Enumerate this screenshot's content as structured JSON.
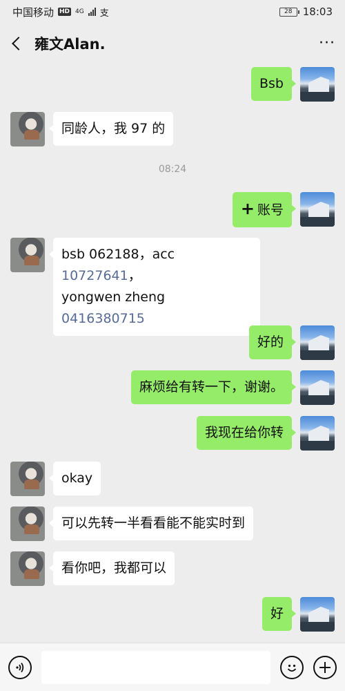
{
  "statusbar": {
    "carrier": "中国移动",
    "hd": "HD",
    "network": "4G",
    "extra_icon": "支",
    "battery": "28",
    "time": "18:03"
  },
  "header": {
    "title": "雍文Alan.",
    "more": "···"
  },
  "messages": [
    {
      "side": "out",
      "text": "Bsb"
    },
    {
      "side": "in",
      "text": "同龄人，我 97 的"
    },
    {
      "type": "time",
      "text": "08:24"
    },
    {
      "side": "out",
      "icon": "+",
      "text": "账号"
    },
    {
      "side": "in",
      "parts": [
        "bsb 062188，acc ",
        "10727641",
        "，",
        "yongwen zheng",
        "0416380715"
      ]
    },
    {
      "side": "out",
      "text": "好的"
    },
    {
      "side": "out",
      "text": "麻烦给有转一下，谢谢。"
    },
    {
      "side": "out",
      "text": "我现在给你转"
    },
    {
      "side": "in",
      "text": "okay"
    },
    {
      "side": "in",
      "text": "可以先转一半看看能不能实时到"
    },
    {
      "side": "in",
      "text": "看你吧，我都可以"
    },
    {
      "side": "out",
      "text": "好"
    }
  ],
  "inputbar": {
    "voice_icon": "voice-icon",
    "emoji_icon": "emoji-icon",
    "plus_icon": "plus-icon",
    "value": ""
  },
  "colors": {
    "bg": "#ededed",
    "outgoing_bubble": "#95ec69",
    "incoming_bubble": "#ffffff",
    "link": "#576b95"
  }
}
